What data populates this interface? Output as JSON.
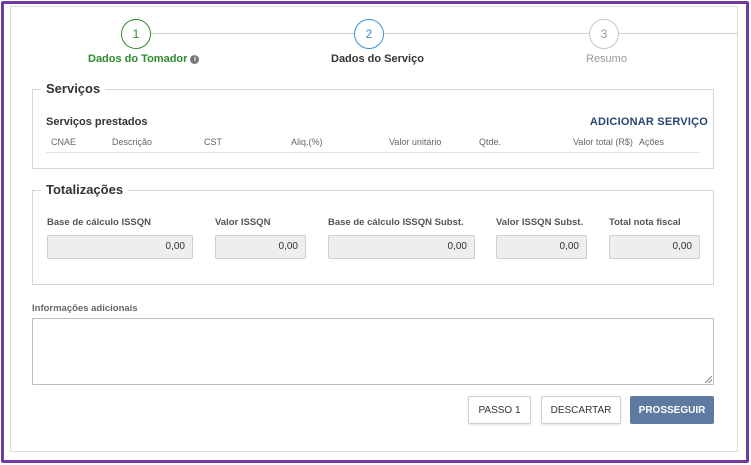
{
  "stepper": {
    "steps": [
      {
        "number": "1",
        "label": "Dados do Tomador",
        "state": "done"
      },
      {
        "number": "2",
        "label": "Dados do Serviço",
        "state": "active"
      },
      {
        "number": "3",
        "label": "Resumo",
        "state": "todo"
      }
    ],
    "info_icon_glyph": "i"
  },
  "servicos": {
    "legend": "Serviços",
    "subtitle": "Serviços prestados",
    "add_label": "ADICIONAR SERVIÇO",
    "columns": [
      "CNAE",
      "Descrição",
      "CST",
      "Aliq.(%)",
      "Valor unitário",
      "Qtde.",
      "Valor total (R$)",
      "Ações"
    ]
  },
  "totalizacoes": {
    "legend": "Totalizações",
    "fields": [
      {
        "label": "Base de cálculo ISSQN",
        "value": "0,00"
      },
      {
        "label": "Valor ISSQN",
        "value": "0,00"
      },
      {
        "label": "Base de cálculo ISSQN Subst.",
        "value": "0,00"
      },
      {
        "label": "Valor ISSQN Subst.",
        "value": "0,00"
      },
      {
        "label": "Total nota fiscal",
        "value": "0,00"
      }
    ]
  },
  "informacoes": {
    "label": "Informações adicionais",
    "value": ""
  },
  "actions": {
    "passo1": "PASSO 1",
    "descartar": "DESCARTAR",
    "prosseguir": "PROSSEGUIR"
  },
  "colors": {
    "frame": "#6e3aa5",
    "step_done": "#2e8b2e",
    "step_active": "#3a8fd9",
    "link": "#23466e",
    "primary_button": "#5d7aa0"
  }
}
